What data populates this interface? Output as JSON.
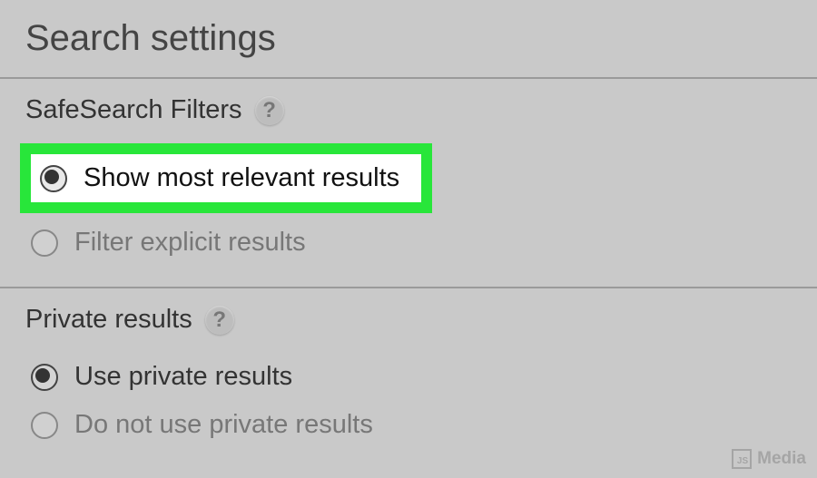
{
  "page_title": "Search settings",
  "sections": {
    "safesearch": {
      "title": "SafeSearch Filters",
      "help_symbol": "?",
      "options": [
        {
          "label": "Show most relevant results",
          "selected": true,
          "highlighted": true
        },
        {
          "label": "Filter explicit results",
          "selected": false,
          "highlighted": false
        }
      ]
    },
    "private": {
      "title": "Private results",
      "help_symbol": "?",
      "options": [
        {
          "label": "Use private results",
          "selected": true
        },
        {
          "label": "Do not use private results",
          "selected": false
        }
      ]
    }
  },
  "watermark": {
    "badge": "JS",
    "text": "Media"
  },
  "colors": {
    "highlight_border": "#28e63a",
    "highlight_bg": "#ffffff",
    "page_bg": "#c9c9c9"
  }
}
